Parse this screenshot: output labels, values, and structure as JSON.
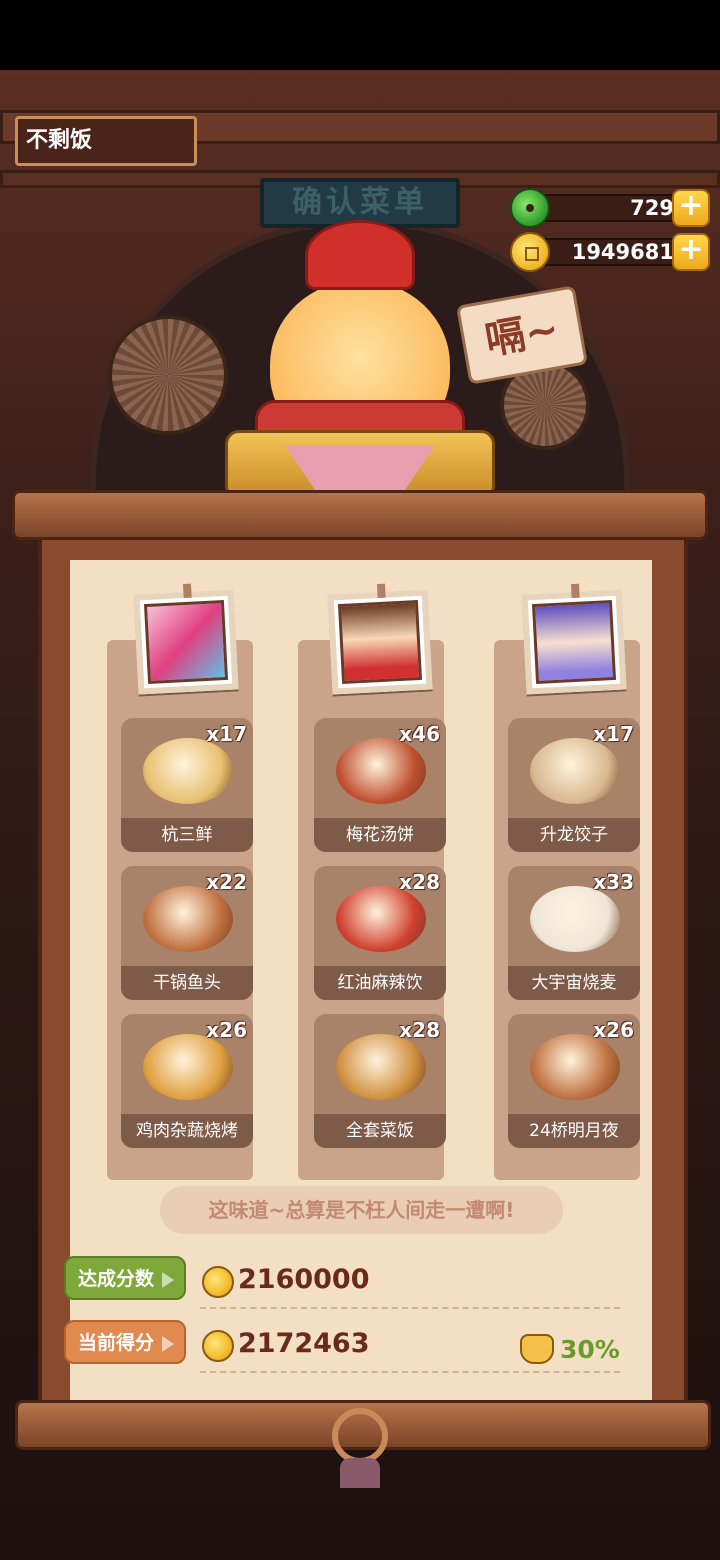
{
  "restaurant": {
    "name": "不剩饭",
    "plaque": "确认菜单"
  },
  "currency": {
    "jade": "729",
    "coins": "1949681"
  },
  "speech": "嗝~",
  "customers": [
    {
      "dishes": [
        {
          "name": "杭三鲜",
          "count": "x17",
          "color": "#e8c070"
        },
        {
          "name": "干锅鱼头",
          "count": "x22",
          "color": "#c07040"
        },
        {
          "name": "鸡肉杂蔬烧烤",
          "count": "x26",
          "color": "#e0a040"
        }
      ]
    },
    {
      "dishes": [
        {
          "name": "梅花汤饼",
          "count": "x46",
          "color": "#c05030"
        },
        {
          "name": "红油麻辣饮",
          "count": "x28",
          "color": "#d04030"
        },
        {
          "name": "全套菜饭",
          "count": "x28",
          "color": "#d09040"
        }
      ]
    },
    {
      "dishes": [
        {
          "name": "升龙饺子",
          "count": "x17",
          "color": "#d8b890"
        },
        {
          "name": "大宇宙烧麦",
          "count": "x33",
          "color": "#f0e6d8"
        },
        {
          "name": "24桥明月夜",
          "count": "x26",
          "color": "#c07040"
        }
      ]
    }
  ],
  "quote": "这味道~总算是不枉人间走一遭啊!",
  "target": {
    "label": "达成分数",
    "value": "2160000"
  },
  "current": {
    "label": "当前得分",
    "value": "2172463"
  },
  "bonus": "30%"
}
